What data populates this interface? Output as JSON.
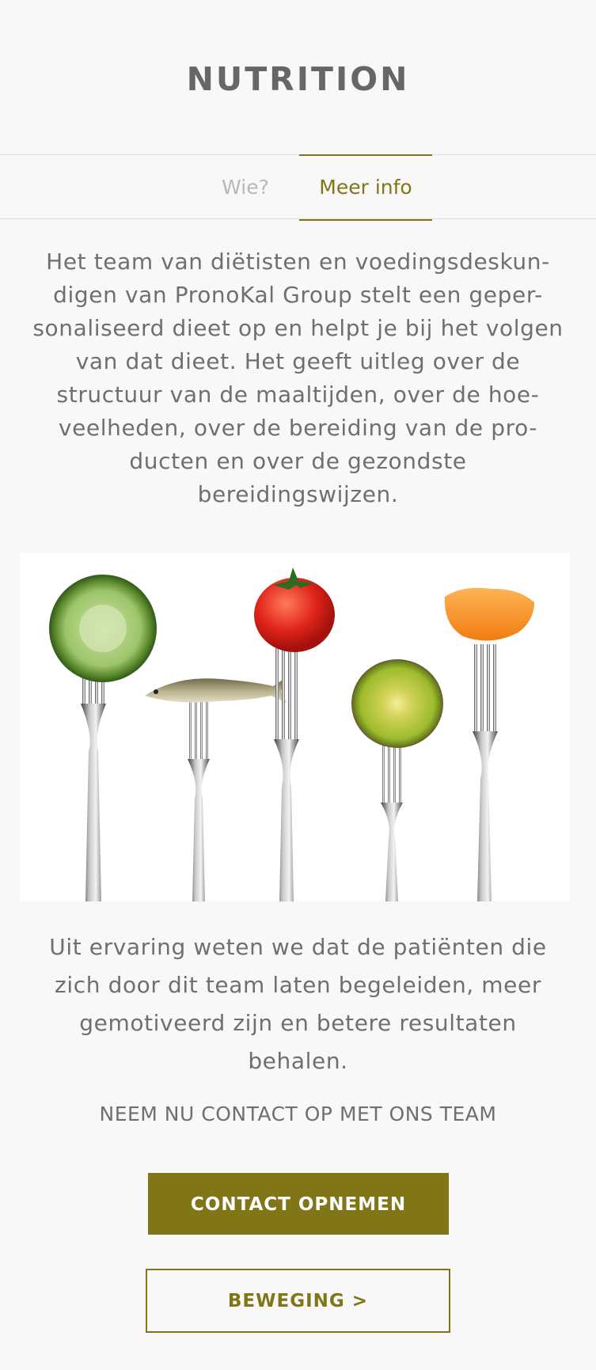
{
  "header": {
    "title": "NUTRITION"
  },
  "tabs": [
    {
      "label": "Wie?",
      "active": false
    },
    {
      "label": "Meer info",
      "active": true
    }
  ],
  "content": {
    "intro": "Het team van diëtisten en voedingsdeskun-digen van PronoKal Group stelt een geper-sonaliseerd dieet op en helpt je bij het volgen van dat dieet. Het geeft uitleg over de structuur van de maaltijden, over de hoe-veelheden, over de bereiding van de pro-ducten en over de gezondste bereidingswijzen.",
    "outro": "Uit ervaring weten we dat de patiënten die zich door dit team laten begeleiden, meer gemotiveerd zijn en betere resultaten behalen.",
    "cta_heading": "NEEM NU CONTACT OP MET ONS TEAM"
  },
  "buttons": {
    "contact": "CONTACT OPNEMEN",
    "beweging": "BEWEGING >"
  },
  "colors": {
    "accent": "#807618",
    "text": "#6f6f6f",
    "background": "#f8f8f8"
  }
}
